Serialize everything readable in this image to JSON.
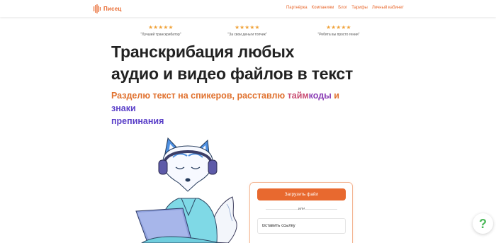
{
  "header": {
    "logo_text": "Писец",
    "nav": [
      "Партнёрка",
      "Компаниям",
      "Блог",
      "Тарифы",
      "Личный кабинет"
    ]
  },
  "reviews": [
    {
      "stars": "★★★★★",
      "quote": "\"Лучший транскрибатор\""
    },
    {
      "stars": "★★★★★",
      "quote": "\"За свои деньги топчик\""
    },
    {
      "stars": "★★★★★",
      "quote": "\"Ребята вы просто гении\""
    }
  ],
  "hero": {
    "title_line1": "Транскрибация любых",
    "title_line2": "аудио и видео файлов в текст",
    "subtitle": {
      "p1": "Разделю текст на спикеров, расставлю ",
      "p2": "тайм",
      "p3": "коды",
      "p4": " и ",
      "p5": "знаки",
      "p6": "препинания"
    }
  },
  "upload": {
    "button_label": "Загрузить файл",
    "or_label": "или",
    "link_placeholder": "Вставить ссылку"
  },
  "help": {
    "label": "?"
  },
  "colors": {
    "accent": "#e8692f",
    "stars": "#f0a33a",
    "help": "#4cb85a"
  }
}
